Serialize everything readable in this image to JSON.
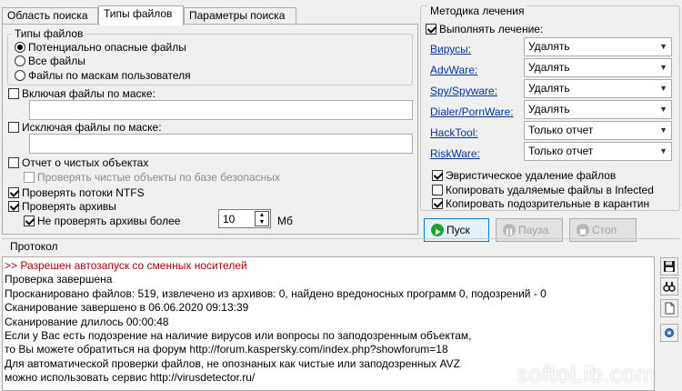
{
  "tabs": [
    {
      "label": "Область поиска"
    },
    {
      "label": "Типы файлов"
    },
    {
      "label": "Параметры поиска"
    }
  ],
  "file_types": {
    "group_title": "Типы файлов",
    "options": [
      {
        "label": "Потенциально опасные файлы",
        "selected": true
      },
      {
        "label": "Все файлы",
        "selected": false
      },
      {
        "label": "Файлы по маскам пользователя",
        "selected": false
      }
    ]
  },
  "include_mask": {
    "label": "Включая файлы по маске:",
    "value": ""
  },
  "exclude_mask": {
    "label": "Исключая файлы по маске:",
    "value": ""
  },
  "checks": {
    "clean_report": "Отчет о чистых объектах",
    "check_clean_db": "Проверять чистые объекты по базе безопасных",
    "ntfs_streams": "Проверять потоки NTFS",
    "archives": "Проверять архивы",
    "skip_archives_over": "Не проверять архивы более"
  },
  "archive_limit": {
    "value": "10",
    "unit": "Мб"
  },
  "method": {
    "title": "Методика лечения",
    "perform_label": "Выполнять лечение:",
    "rows": [
      {
        "name": "Вирусы:",
        "action": "Удалять"
      },
      {
        "name": "AdvWare:",
        "action": "Удалять"
      },
      {
        "name": "Spy/Spyware:",
        "action": "Удалять"
      },
      {
        "name": "Dialer/PornWare:",
        "action": "Удалять"
      },
      {
        "name": "HackTool:",
        "action": "Только отчет"
      },
      {
        "name": "RiskWare:",
        "action": "Только отчет"
      }
    ],
    "heuristic": "Эвристическое удаление файлов",
    "copy_deleted": "Копировать удаляемые файлы в  Infected",
    "copy_suspicious": "Копировать подозрительные в  карантин"
  },
  "buttons": {
    "start": "Пуск",
    "pause": "Пауза",
    "stop": "Стоп"
  },
  "protocol": {
    "title": "Протокол",
    "lines": [
      ">> Разрешен автозапуск со сменных носителей",
      "Проверка завершена",
      "Просканировано файлов: 519, извлечено из архивов: 0, найдено вредоносных программ 0, подозрений - 0",
      "Сканирование завершено в 06.06.2020 09:13:39",
      "Сканирование длилось 00:00:48",
      "Если у Вас есть подозрение на наличие вирусов или вопросы по заподозренным объектам,",
      "то Вы можете обратиться на форум http://forum.kaspersky.com/index.php?showforum=18",
      "Для автоматической проверки файлов, не опознаных как чистые или заподозренных AVZ",
      "можно использовать сервис http://virusdetector.ru/"
    ]
  },
  "watermark": "softoLib.com",
  "colors": {
    "link": "#0033aa",
    "log_red": "#b00000",
    "start_icon": "#22a032",
    "disabled": "#a0a0a0"
  }
}
